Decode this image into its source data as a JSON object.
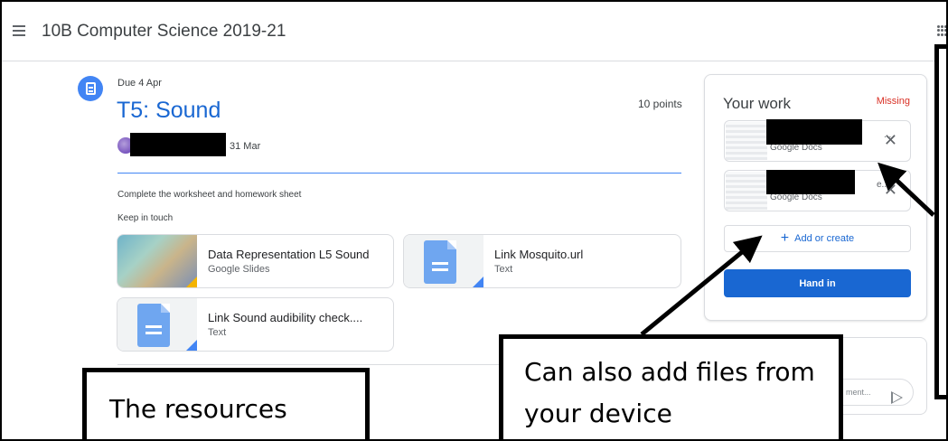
{
  "header": {
    "class_title": "10B Computer Science 2019-21"
  },
  "assignment": {
    "due": "Due 4 Apr",
    "title": "T5: Sound",
    "points": "10 points",
    "posted_date": "31 Mar",
    "description": "Complete the worksheet and homework sheet",
    "keep_in_touch": "Keep in touch"
  },
  "materials": [
    {
      "name": "Data Representation L5 Sound",
      "type": "Google Slides"
    },
    {
      "name": "Link Mosquito.url",
      "type": "Text"
    },
    {
      "name": "Link Sound audibility check....",
      "type": "Text"
    }
  ],
  "your_work": {
    "title": "Your work",
    "status": "Missing",
    "status_color": "#d93025",
    "files": [
      {
        "name_suffix": "...",
        "type": "Google Docs"
      },
      {
        "name_suffix": "e...",
        "type": "Google Docs"
      }
    ],
    "add_label": "Add or create",
    "hand_in_label": "Hand in"
  },
  "comment": {
    "placeholder": "ment..."
  },
  "callouts": {
    "resources": "The resources",
    "files": "Can also add files from your device"
  },
  "colors": {
    "accent": "#1967d2",
    "assignment_icon": "#4285f4"
  }
}
